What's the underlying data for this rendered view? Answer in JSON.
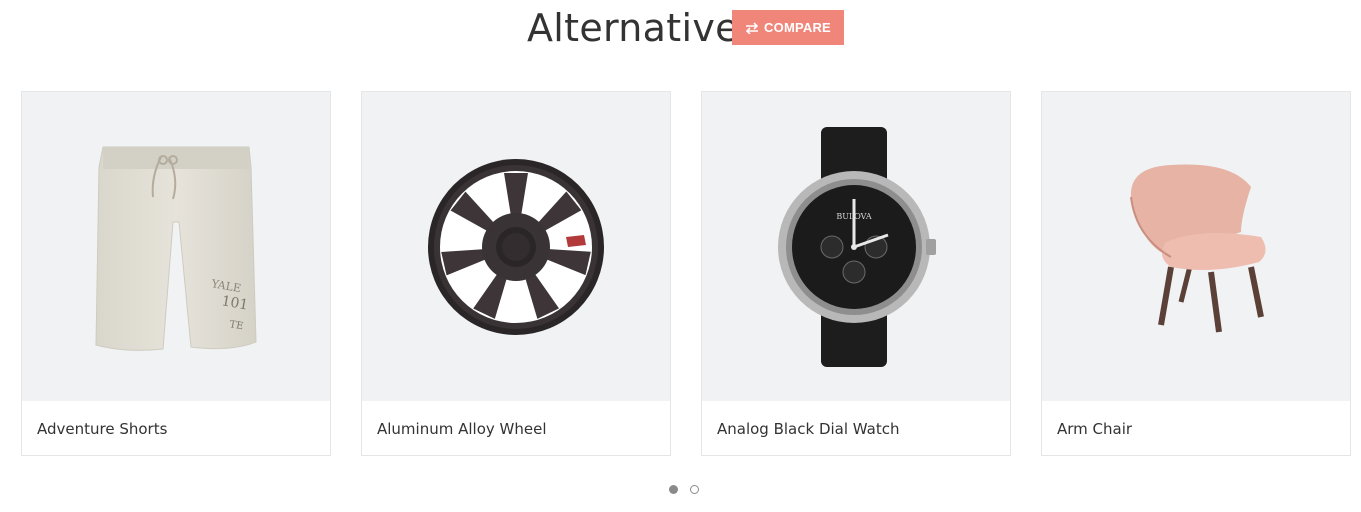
{
  "header": {
    "title": "Alternative",
    "compare_label": "COMPARE"
  },
  "products": [
    {
      "name": "Adventure Shorts",
      "icon": "shorts-image"
    },
    {
      "name": "Aluminum Alloy Wheel",
      "icon": "wheel-image"
    },
    {
      "name": "Analog Black Dial Watch",
      "icon": "watch-image",
      "watch_brand": "BULOVA"
    },
    {
      "name": "Arm Chair",
      "icon": "chair-image"
    }
  ],
  "pagination": {
    "active_page": 1,
    "pages": 2
  },
  "colors": {
    "accent": "#f0857a",
    "card_bg": "#f1f2f4",
    "text": "#333333"
  }
}
